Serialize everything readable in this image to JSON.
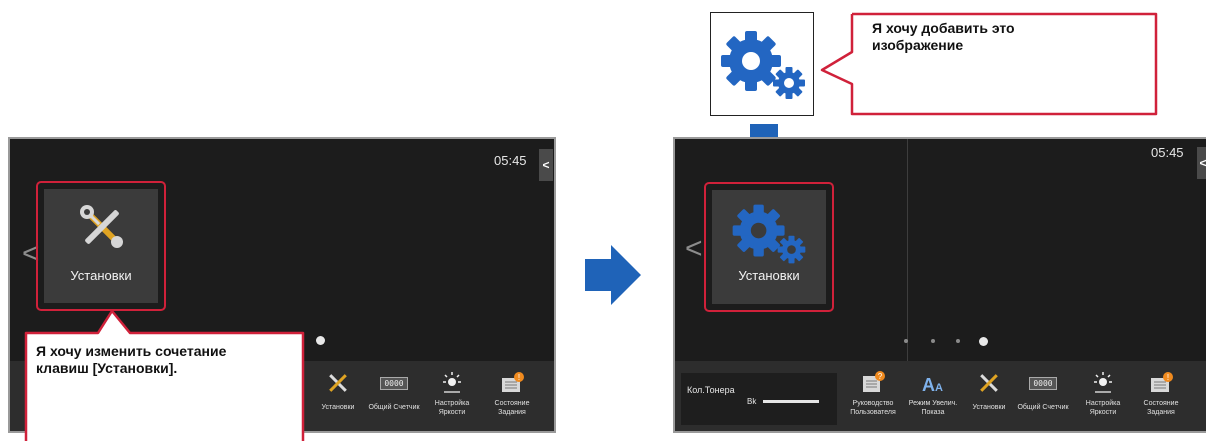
{
  "left_screen": {
    "clock": "05:45",
    "side_tab_glyph": "<",
    "prev_arrow": "<",
    "tile_label": "Установки",
    "dock": [
      {
        "label": "Установки",
        "icon": "wrench-icon"
      },
      {
        "label": "Общий Счетчик",
        "icon": "counter-icon"
      },
      {
        "label": "Настройка Яркости",
        "icon": "brightness-icon"
      },
      {
        "label": "Состояние Задания",
        "icon": "job-status-icon"
      }
    ]
  },
  "left_callout": {
    "text": "Я хочу изменить сочетание клавиш [Установки]."
  },
  "right_screen": {
    "clock": "05:45",
    "side_tab_glyph": "<",
    "prev_arrow": "<",
    "tile_label": "Установки",
    "toner_label": "Кол.Тонера",
    "toner_color": "Bk",
    "dock": [
      {
        "label": "Руководство Пользователя",
        "icon": "user-guide-icon"
      },
      {
        "label": "Режим Увелич. Показа",
        "icon": "magnify-text-icon"
      },
      {
        "label": "Установки",
        "icon": "wrench-icon"
      },
      {
        "label": "Общий Счетчик",
        "icon": "counter-icon"
      },
      {
        "label": "Настройка Яркости",
        "icon": "brightness-icon"
      },
      {
        "label": "Состояние Задания",
        "icon": "job-status-icon"
      }
    ]
  },
  "right_callout": {
    "text": "Я хочу добавить это изображение"
  },
  "counter_display": "0000",
  "colors": {
    "highlight_red": "#d0213a",
    "arrow_blue": "#1f63b8",
    "gear_blue": "#2366c2",
    "screen_bg": "#1c1c1c"
  }
}
